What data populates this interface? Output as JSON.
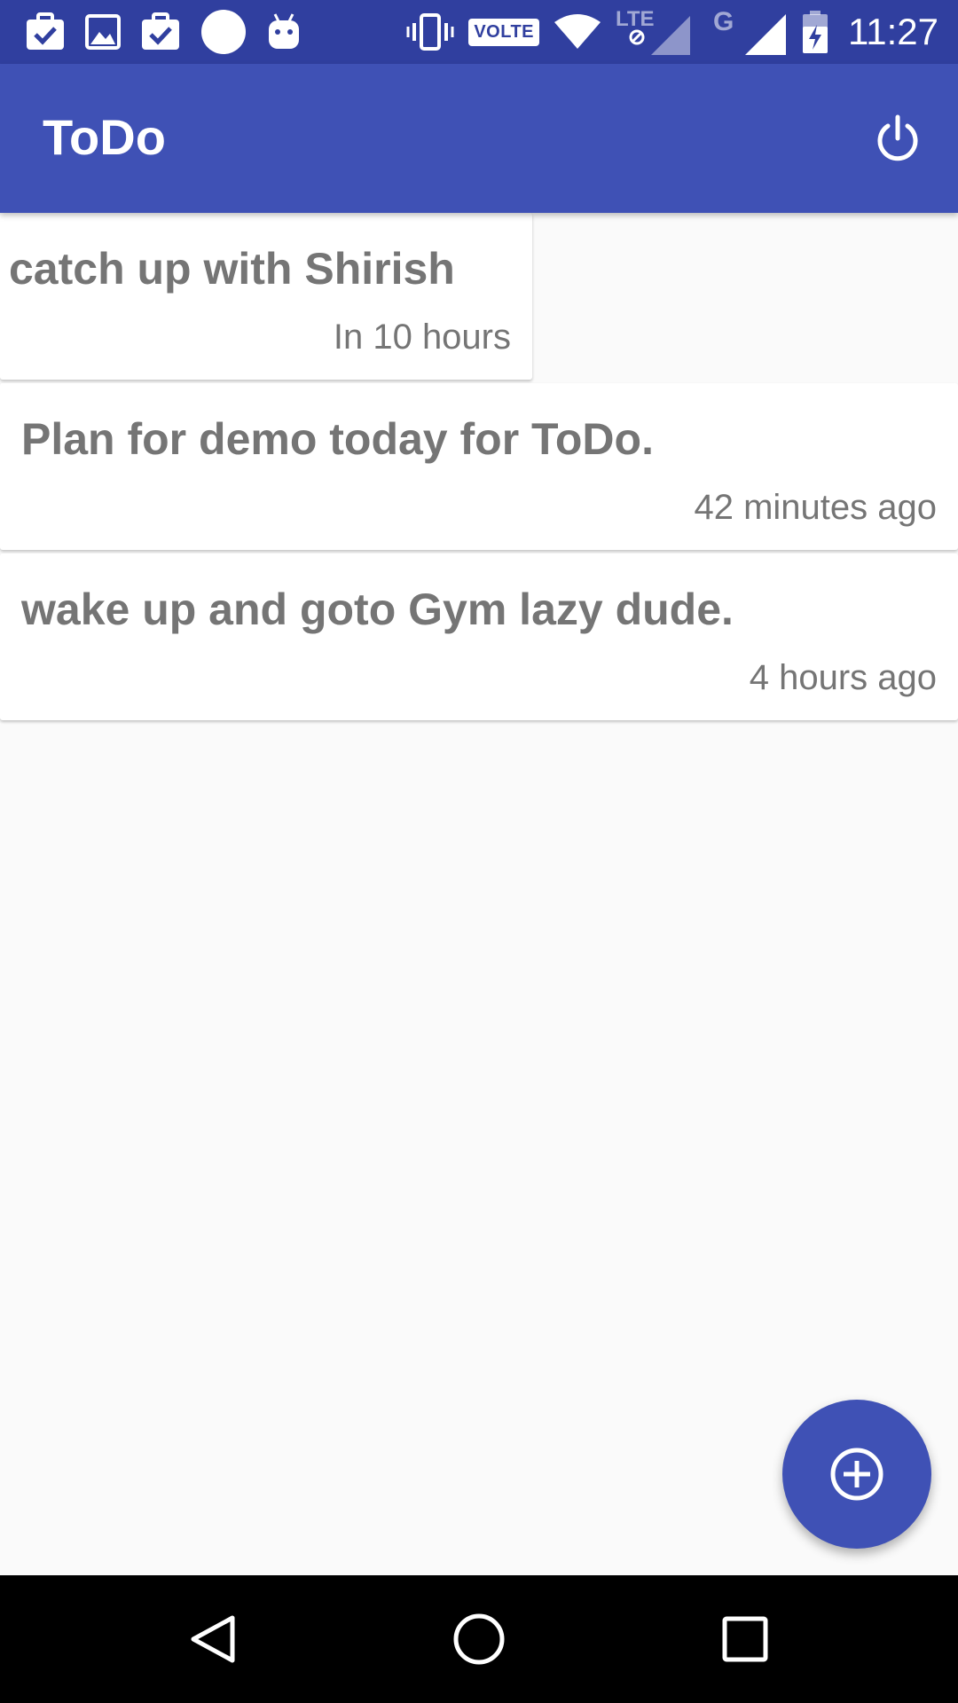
{
  "status_bar": {
    "time": "11:27",
    "volte_label": "VOLTE",
    "lte_label": "LTE",
    "g_label": "G",
    "icons_left": [
      "task-check-icon",
      "image-icon",
      "task-check-icon",
      "circle-icon",
      "android-icon"
    ],
    "icons_right": [
      "vibrate-icon",
      "volte-badge",
      "wifi-icon",
      "lte-signal-icon",
      "g-signal-icon",
      "battery-charging-icon"
    ]
  },
  "app_bar": {
    "title": "ToDo",
    "action_icon": "power-icon"
  },
  "todos": [
    {
      "title": "catch up with Shirish",
      "time": "In 10 hours"
    },
    {
      "title": "Plan for demo today for ToDo.",
      "time": "42 minutes ago"
    },
    {
      "title": "wake up and goto Gym lazy dude.",
      "time": "4 hours ago"
    }
  ],
  "fab": {
    "icon": "add-circle-icon"
  },
  "nav_bar": {
    "icons": [
      "back-icon",
      "home-icon",
      "recents-icon"
    ]
  },
  "colors": {
    "status_bar": "#303f9f",
    "primary": "#3f51b5",
    "text_secondary": "#757575",
    "background": "#fafafa"
  }
}
